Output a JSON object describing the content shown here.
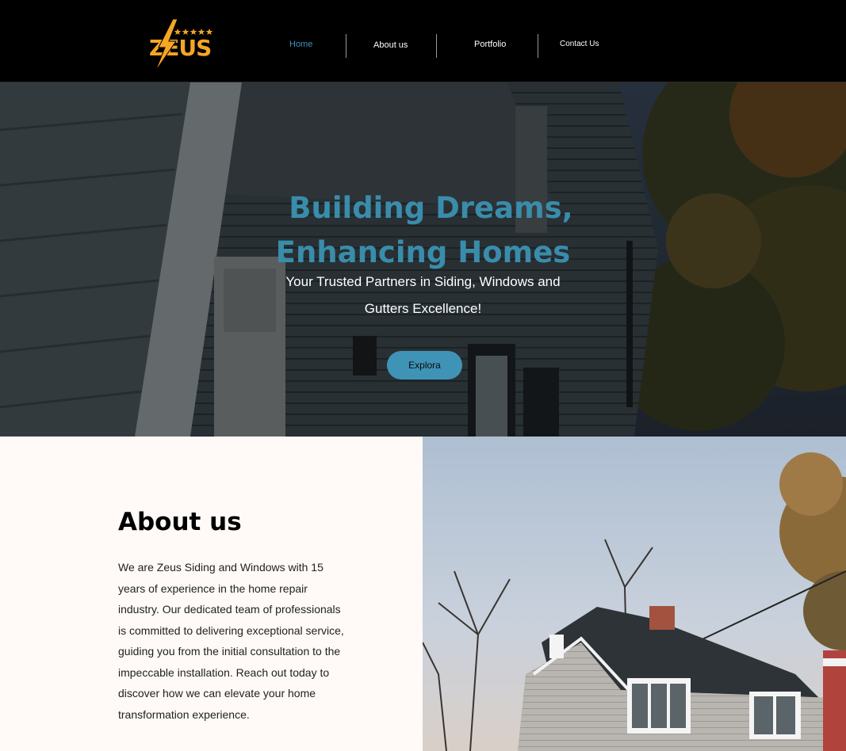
{
  "brand": {
    "logo_text": "ZEUS",
    "accent": "#f5a623"
  },
  "nav": {
    "items": [
      {
        "label": "Home",
        "active": true
      },
      {
        "label": "About us",
        "active": false
      },
      {
        "label": "Portfolio",
        "active": false
      },
      {
        "label": "Contact Us",
        "active": false
      }
    ]
  },
  "hero": {
    "title_line1": "Building Dreams,",
    "title_line2": "Enhancing Homes",
    "subtitle_line1": "Your Trusted Partners in Siding, Windows and",
    "subtitle_line2": "Gutters Excellence!",
    "button_label": "Explora",
    "title_color": "#3a8cab",
    "button_color": "#3f93b6"
  },
  "about": {
    "title": "About us",
    "body": "We are Zeus Siding and Windows with 15 years of experience in the home repair industry. Our dedicated team of professionals is committed to delivering exceptional service, guiding you from the initial consultation to the impeccable installation. Reach out today to discover how we can elevate your home transformation experience."
  }
}
